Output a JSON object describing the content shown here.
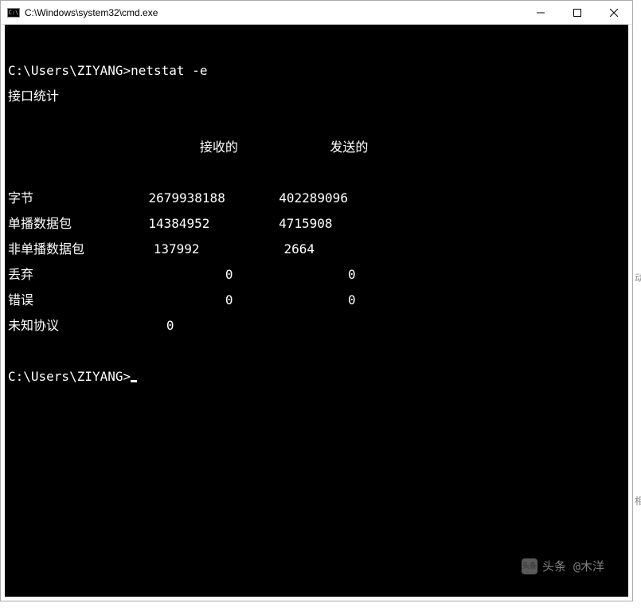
{
  "window": {
    "title": "C:\\Windows\\system32\\cmd.exe",
    "icon_label": "C:\\"
  },
  "terminal": {
    "blank": "",
    "prompt1": "C:\\Users\\ZIYANG>",
    "command1": "netstat -e",
    "header": "接口统计",
    "col_header": "                         接收的            发送的",
    "row_bytes": "字节               2679938188       402289096",
    "row_unicast": "单播数据包          14384952         4715908",
    "row_nonuni": "非单播数据包         137992           2664",
    "row_discard": "丢弃                         0               0",
    "row_error": "错误                         0               0",
    "row_unknown": "未知协议              0",
    "prompt2": "C:\\Users\\ZIYANG>"
  },
  "watermark": {
    "logo": "头条",
    "text": "头条 @木洋"
  }
}
